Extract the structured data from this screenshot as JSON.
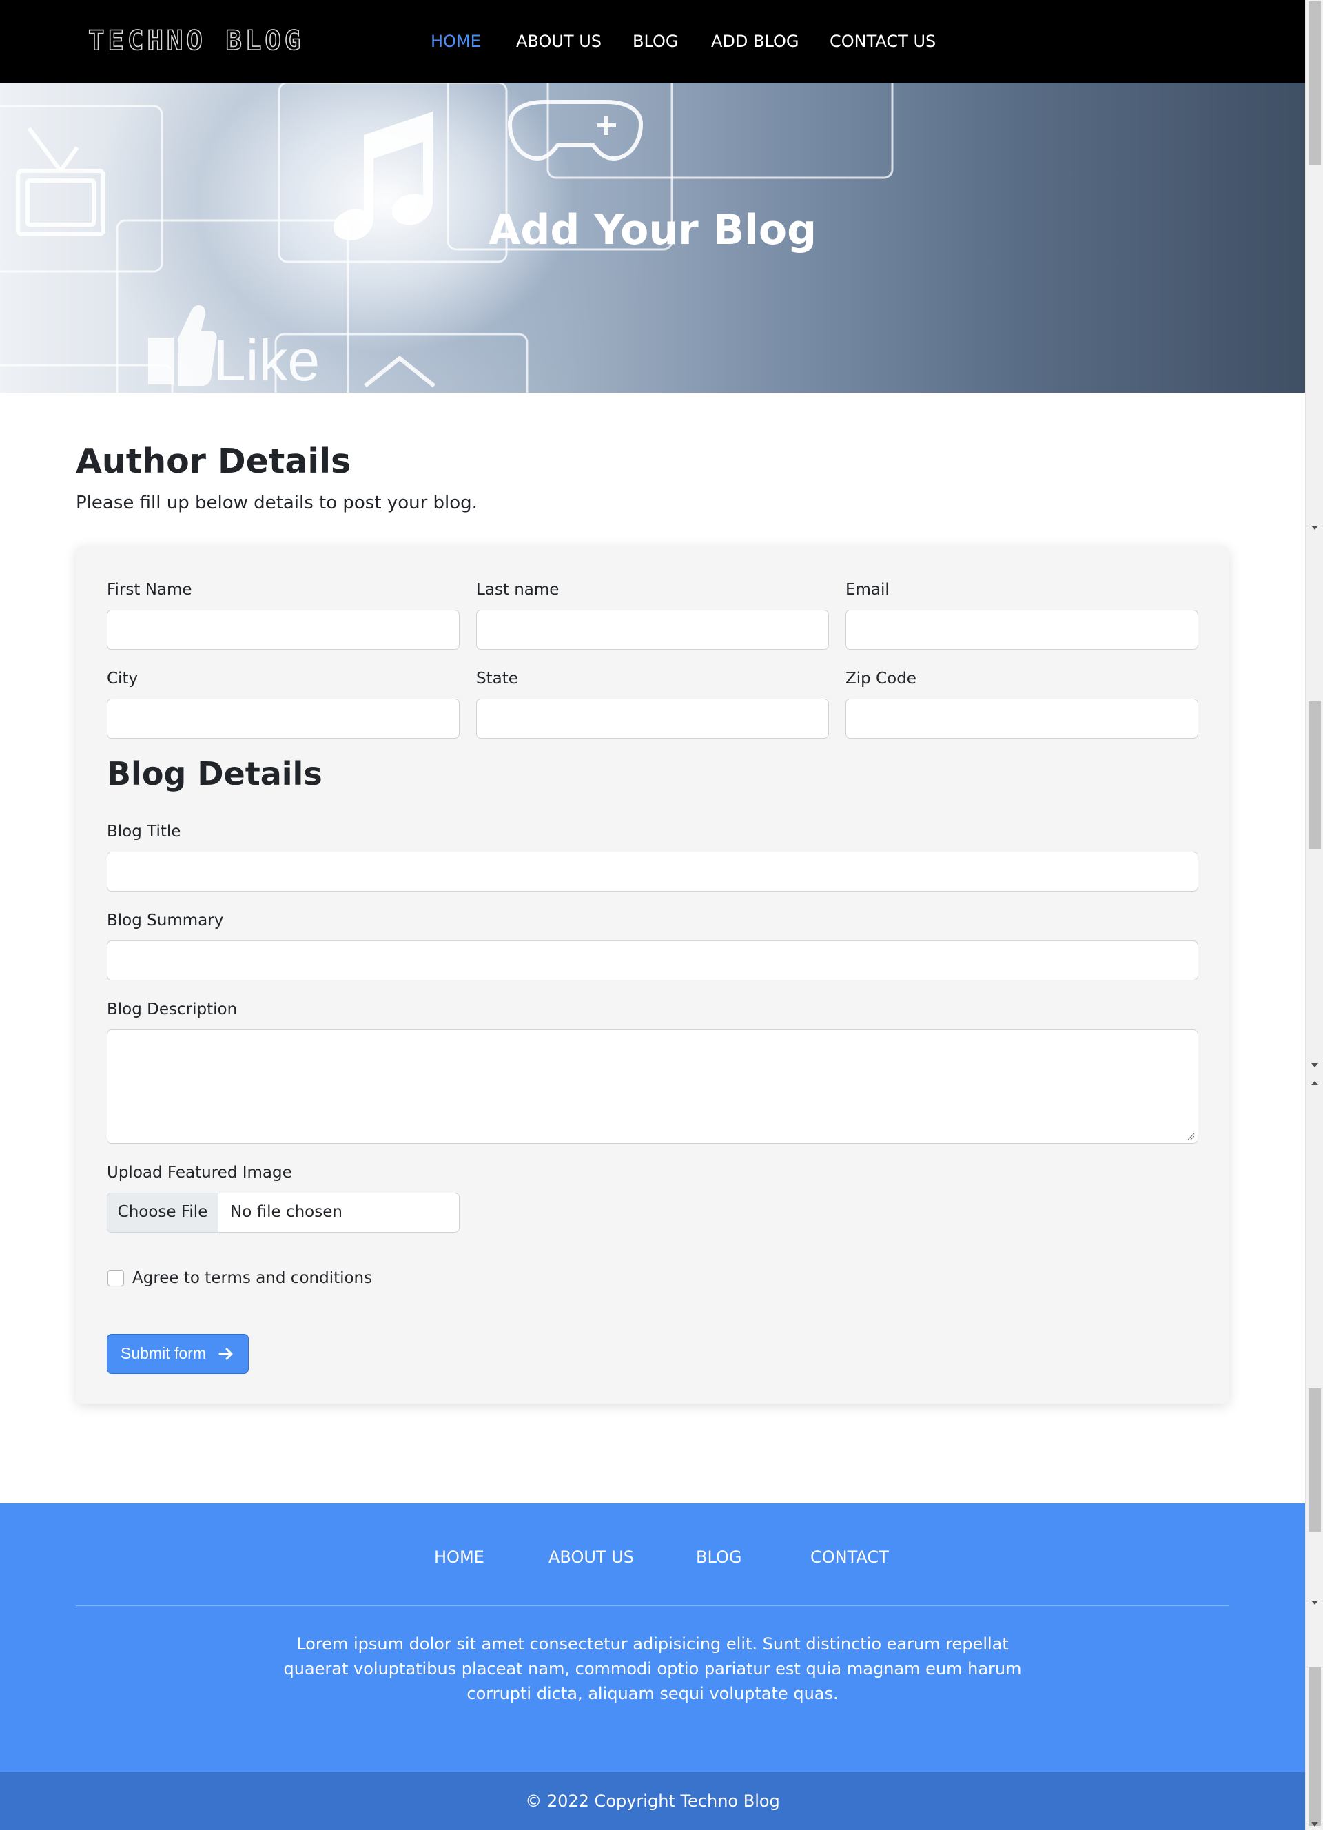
{
  "nav": {
    "logo": "TECHNO BLOG",
    "links": [
      "HOME",
      "ABOUT US",
      "BLOG",
      "ADD BLOG",
      "CONTACT US"
    ],
    "active": "HOME",
    "active_color": "#4a8ff5"
  },
  "hero": {
    "title": "Add Your Blog",
    "image_text": "Like"
  },
  "author": {
    "title": "Author Details",
    "subtitle": "Please fill up below details to post your blog.",
    "first_name_label": "First Name",
    "last_name_label": "Last name",
    "email_label": "Email",
    "city_label": "City",
    "state_label": "State",
    "zip_label": "Zip Code"
  },
  "blog": {
    "title": "Blog Details",
    "title_label": "Blog Title",
    "summary_label": "Blog Summary",
    "description_label": "Blog Description",
    "upload_label": "Upload Featured Image",
    "choose_file": "Choose File",
    "no_file": "No file chosen",
    "agree_label": "Agree to terms and conditions",
    "submit_label": "Submit form",
    "submit_icon": "arrow-right-icon"
  },
  "footer": {
    "links": [
      "HOME",
      "ABOUT US",
      "BLOG",
      "CONTACT"
    ],
    "text": "Lorem ipsum dolor sit amet consectetur adipisicing elit. Sunt distinctio earum repellat quaerat voluptatibus placeat nam, commodi optio pariatur est quia magnam eum harum corrupti dicta, aliquam sequi voluptate quas.",
    "copyright": "© 2022 Copyright Techno Blog",
    "background": "#4a8ff5",
    "copyright_background": "#3a73cc"
  }
}
